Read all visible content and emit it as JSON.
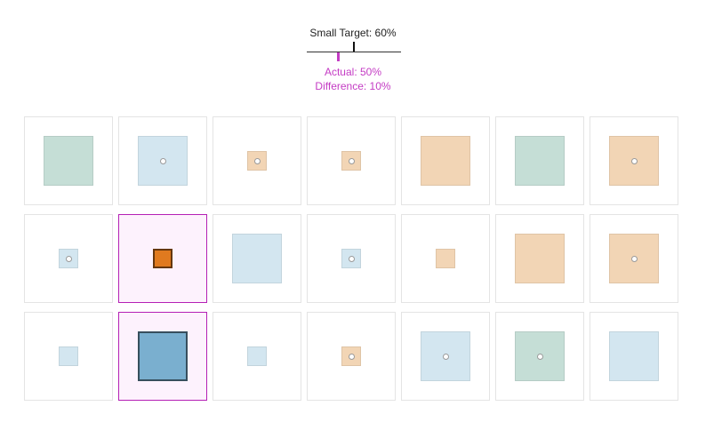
{
  "header": {
    "target_text": "Small Target: 60%",
    "target_value": 60,
    "actual_text": "Actual: 50%",
    "actual_value": 50,
    "difference_text": "Difference: 10%"
  },
  "colors": {
    "accent": "#c43cc4",
    "green": "#c5ded6",
    "blue": "#d3e6f0",
    "orange": "#f2d5b5",
    "orange_selected": "#e07a1f",
    "blue_selected": "#7aafcf"
  },
  "grid": [
    [
      {
        "color": "green",
        "size": "large",
        "dot": false,
        "selected": false
      },
      {
        "color": "blue",
        "size": "large",
        "dot": true,
        "selected": false
      },
      {
        "color": "orange",
        "size": "small",
        "dot": true,
        "selected": false
      },
      {
        "color": "orange",
        "size": "small",
        "dot": true,
        "selected": false
      },
      {
        "color": "orange",
        "size": "large",
        "dot": false,
        "selected": false
      },
      {
        "color": "green",
        "size": "large",
        "dot": false,
        "selected": false
      },
      {
        "color": "orange",
        "size": "large",
        "dot": true,
        "selected": false
      }
    ],
    [
      {
        "color": "blue",
        "size": "small",
        "dot": true,
        "selected": false
      },
      {
        "color": "orange_selected",
        "size": "small",
        "dot": false,
        "selected": true
      },
      {
        "color": "blue",
        "size": "large",
        "dot": false,
        "selected": false
      },
      {
        "color": "blue",
        "size": "small",
        "dot": true,
        "selected": false
      },
      {
        "color": "orange",
        "size": "small",
        "dot": false,
        "selected": false
      },
      {
        "color": "orange",
        "size": "large",
        "dot": false,
        "selected": false
      },
      {
        "color": "orange",
        "size": "large",
        "dot": true,
        "selected": false
      }
    ],
    [
      {
        "color": "blue",
        "size": "small",
        "dot": false,
        "selected": false
      },
      {
        "color": "blue_selected",
        "size": "large",
        "dot": false,
        "selected": true
      },
      {
        "color": "blue",
        "size": "small",
        "dot": false,
        "selected": false
      },
      {
        "color": "orange",
        "size": "small",
        "dot": true,
        "selected": false
      },
      {
        "color": "blue",
        "size": "large",
        "dot": true,
        "selected": false
      },
      {
        "color": "green",
        "size": "large",
        "dot": true,
        "selected": false
      },
      {
        "color": "blue",
        "size": "large",
        "dot": false,
        "selected": false
      }
    ]
  ]
}
